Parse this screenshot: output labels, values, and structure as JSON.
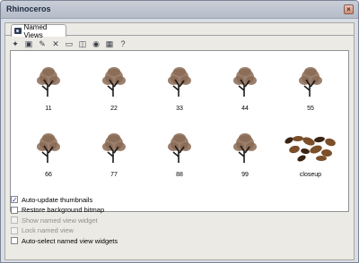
{
  "window": {
    "title": "Rhinoceros",
    "close_glyph": "×"
  },
  "panel": {
    "tab_label": "Named Views"
  },
  "toolbar": {
    "buttons": [
      {
        "name": "new-view-icon",
        "glyph": "✦"
      },
      {
        "name": "save-icon",
        "glyph": "▣"
      },
      {
        "name": "edit-icon",
        "glyph": "✎"
      },
      {
        "name": "delete-icon",
        "glyph": "✕"
      },
      {
        "name": "folder-icon",
        "glyph": "▭"
      },
      {
        "name": "camera-icon",
        "glyph": "◫"
      },
      {
        "name": "eye-icon",
        "glyph": "◉"
      },
      {
        "name": "grid-icon",
        "glyph": "▦"
      },
      {
        "name": "help-icon",
        "glyph": "?"
      }
    ]
  },
  "thumbnails": [
    {
      "label": "11"
    },
    {
      "label": "22"
    },
    {
      "label": "33"
    },
    {
      "label": "44"
    },
    {
      "label": "55"
    },
    {
      "label": "66"
    },
    {
      "label": "77"
    },
    {
      "label": "88"
    },
    {
      "label": "99"
    },
    {
      "label": "closeup"
    }
  ],
  "options": [
    {
      "label": "Auto-update thumbnails",
      "checked": true,
      "enabled": true
    },
    {
      "label": "Restore background bitmap",
      "checked": false,
      "enabled": true
    },
    {
      "label": "Show named view widget",
      "checked": false,
      "enabled": false
    },
    {
      "label": "Lock named view",
      "checked": false,
      "enabled": false
    },
    {
      "label": "Auto-select named view widgets",
      "checked": false,
      "enabled": true
    }
  ],
  "colors": {
    "tree_foliage": "#8a6a55",
    "tree_trunk": "#1e1a18",
    "closeup_leaf": "#7a4f2a"
  }
}
